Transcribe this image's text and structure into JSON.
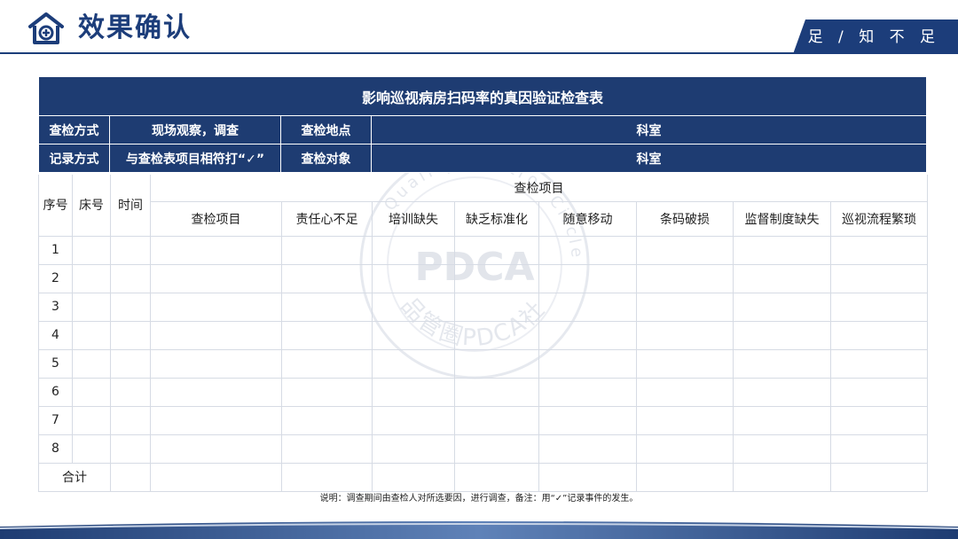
{
  "header": {
    "title": "效果确认",
    "slogan": "知 足 / 知 不 足",
    "logo_icon": "house-plus-icon"
  },
  "title_table": {
    "main_title": "影响巡视病房扫码率的真因验证检查表",
    "row1": {
      "label1": "查检方式",
      "value1": "现场观察，调查",
      "label2": "查检地点",
      "value2": "科室"
    },
    "row2": {
      "label1": "记录方式",
      "value1": "与查检表项目相符打“✓”",
      "label2": "查检对象",
      "value2": "科室"
    }
  },
  "check_table": {
    "col_seq": "序号",
    "col_bed": "床号",
    "col_time": "时间",
    "group_header": "查检项目",
    "items": [
      "查检项目",
      "责任心不足",
      "培训缺失",
      "缺乏标准化",
      "随意移动",
      "条码破损",
      "监督制度缺失",
      "巡视流程繁琐"
    ],
    "rows": [
      "1",
      "2",
      "3",
      "4",
      "5",
      "6",
      "7",
      "8"
    ],
    "total_label": "合计"
  },
  "note": "说明：调查期间由查检人对所选要因，进行调查，备注：用“✓”记录事件的发生。",
  "watermark": {
    "brand": "PDCA",
    "ring_text": "品管圈PDCA社"
  },
  "colors": {
    "primary": "#1e3c72",
    "title_text": "#1c3d7a",
    "border": "#d6dbe4"
  }
}
